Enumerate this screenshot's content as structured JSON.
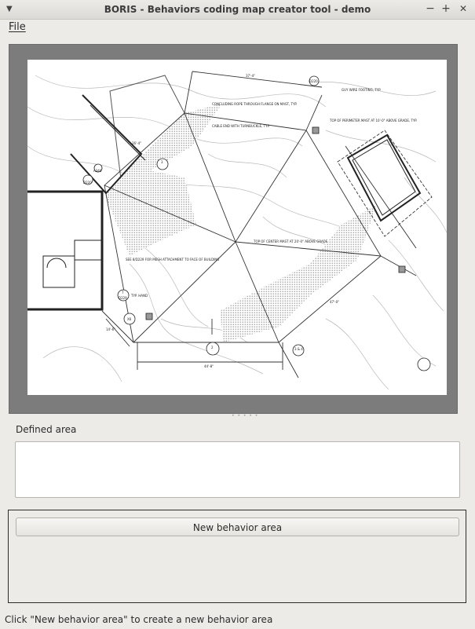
{
  "window": {
    "title": "BORIS - Behaviors coding map creator tool - demo",
    "minimize_glyph": "−",
    "maximize_glyph": "+",
    "close_glyph": "✕"
  },
  "menu": {
    "file_label": "File"
  },
  "map": {
    "labels": {
      "rope_note": "CONCLUDING ROPE THROUGH FLANGE ON MAST, TYP.",
      "cable_note": "CABLE END WITH TURNBUCKLE, TYP.",
      "guy_wire_note": "GUY WIRE FOOTING, TYP.",
      "perimeter_note": "TOP OF PERIMETER MAST AT 10'-0\" ABOVE GRADE, TYP.",
      "center_note": "TOP OF CENTER MAST AT 20'-0\" ABOVE GRADE",
      "mesh_note": "SEE 8/D229 FOR MESH ATTACHMENT TO FACE OF BUILDING",
      "typ_note": "TYP. HAND",
      "dim_top": "37'-4\"",
      "dim_bottom": "44'-8\"",
      "dim_right": "47'-0\"",
      "dim_left": "26'-4\"",
      "dim_lower_left": "14'-6\"",
      "tag_a": "3",
      "tag_b": "A340",
      "tag_c": "D220",
      "tag_d": "7",
      "tag_e": "D229",
      "tag_f": "X6",
      "tag_g": "2",
      "tag_h": "3 & 4",
      "tag_i": "D220"
    }
  },
  "defined_area": {
    "label": "Defined area",
    "value": ""
  },
  "actions": {
    "new_area_button": "New behavior area"
  },
  "status_bar": {
    "text": "Click \"New behavior area\" to create a new behavior area"
  }
}
